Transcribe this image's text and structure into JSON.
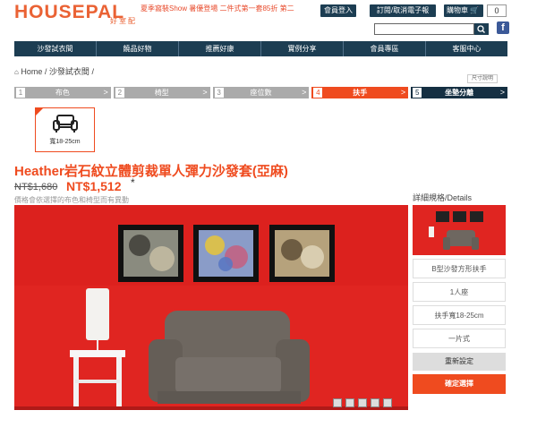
{
  "header": {
    "logo_text": "HOUSEPAL",
    "logo_sub": "好室配",
    "promo": "夏季窩裝Show 暑優登場 二件式第一套85折 第二",
    "login_label": "會員登入",
    "order_label": "訂閱/取消電子報",
    "cart_label": "購物車",
    "cart_count": "0",
    "search_placeholder": "",
    "fb_label": "f"
  },
  "nav": {
    "items": [
      "沙發試衣間",
      "饒品好物",
      "推薦好康",
      "實例分享",
      "會員專區",
      "客服中心"
    ]
  },
  "breadcrumb": {
    "home": "Home",
    "sep1": "/",
    "section": "沙發試衣間",
    "sep2": "/"
  },
  "size_link": "尺寸說明",
  "steps": [
    {
      "num": "1",
      "label": "布色",
      "arrow": ">"
    },
    {
      "num": "2",
      "label": "椅型",
      "arrow": ">"
    },
    {
      "num": "3",
      "label": "座位數",
      "arrow": ">"
    },
    {
      "num": "4",
      "label": "扶手",
      "arrow": ">"
    },
    {
      "num": "5",
      "label": "坐墊分離",
      "arrow": ">"
    }
  ],
  "option_tile": {
    "label": "寬18-25cm"
  },
  "product": {
    "title": "Heather岩石紋立體剪裁單人彈力沙發套(亞麻)",
    "old_price": "NT$1,680",
    "new_price": "NT$1,512",
    "star": "*",
    "note": "價格會依選擇的布色和椅型而有異動"
  },
  "detail": {
    "title": "詳細規格/Details",
    "specs": [
      "B型沙發方形扶手",
      "1人座",
      "扶手寬18-25cm",
      "一片式"
    ],
    "reset_label": "重新設定",
    "confirm_label": "確定選擇"
  },
  "colors": {
    "accent": "#ef4b1f",
    "navy": "#1c3d52",
    "wall": "#e02521",
    "sofa": "#6e6760"
  }
}
